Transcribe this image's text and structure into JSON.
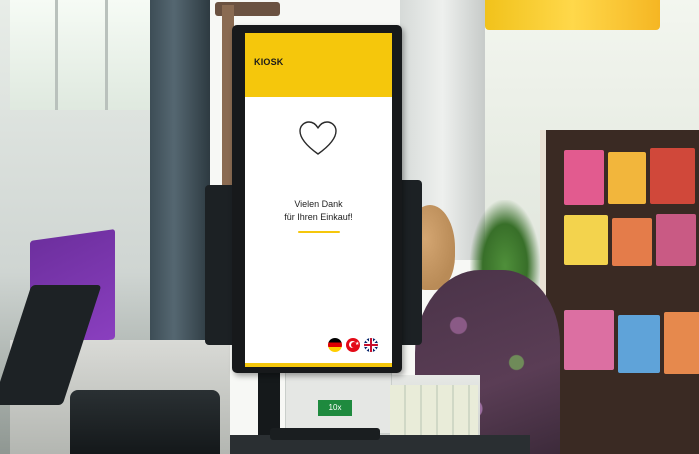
{
  "scene": {
    "description_colors": {
      "kiosk_accent": "#f5c70c",
      "kiosk_bezel": "#17191b",
      "screen_bg": "#ffffff"
    }
  },
  "kiosk": {
    "header_title": "KIOSK",
    "icon": "heart-outline-icon",
    "message_line1": "Vielen Dank",
    "message_line2": "für Ihren Einkauf!",
    "languages": [
      {
        "code": "de",
        "icon": "germany-flag-icon"
      },
      {
        "code": "tr",
        "icon": "turkey-flag-icon"
      },
      {
        "code": "en",
        "icon": "uk-flag-icon"
      }
    ]
  },
  "props": {
    "package_label": "10x"
  }
}
